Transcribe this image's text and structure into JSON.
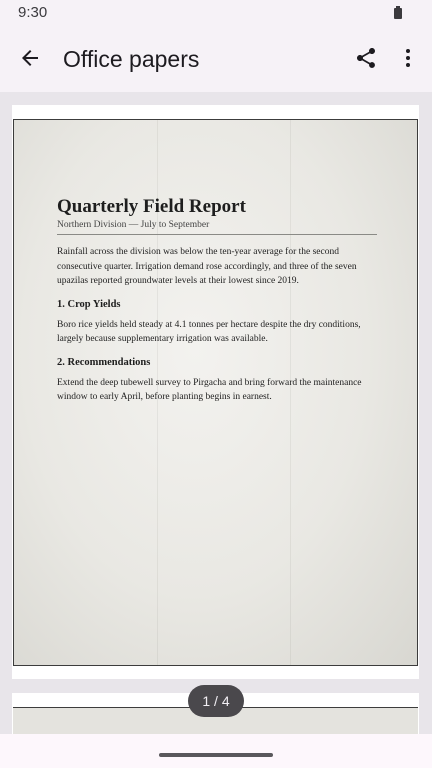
{
  "status_bar": {
    "time": "9:30"
  },
  "app_bar": {
    "title": "Office papers",
    "back_icon": "arrow-back-icon",
    "share_icon": "share-icon",
    "more_icon": "more-vert-icon"
  },
  "document": {
    "title": "Quarterly Field Report",
    "subtitle": "Northern Division — July to September",
    "intro": "Rainfall across the division was below the ten-year average for the second consecutive quarter. Irrigation demand rose accordingly, and three of the seven upazilas reported groundwater levels at their lowest since 2019.",
    "sections": [
      {
        "heading": "1. Crop Yields",
        "body": "Boro rice yields held steady at 4.1 tonnes per hectare despite the dry conditions, largely because supplementary irrigation was available."
      },
      {
        "heading": "2. Recommendations",
        "body": "Extend the deep tubewell survey to Pirgacha and bring forward the maintenance window to early April, before planting begins in earnest."
      }
    ]
  },
  "page_indicator": {
    "text": "1 / 4"
  }
}
